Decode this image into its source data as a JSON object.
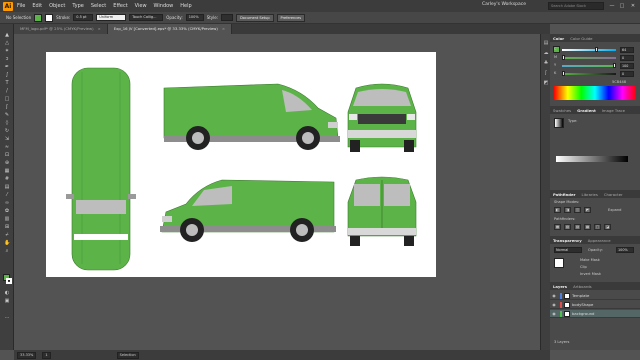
{
  "app": {
    "logo": "Ai",
    "menu": [
      "File",
      "Edit",
      "Object",
      "Type",
      "Select",
      "Effect",
      "View",
      "Window",
      "Help"
    ],
    "workspace": "Carley's Workspace",
    "search_placeholder": "Search Adobe Stock",
    "window_controls": [
      "—",
      "□",
      "✕"
    ]
  },
  "control_bar": {
    "selection": "No Selection",
    "fill_color": "#5cb448",
    "stroke_label": "Stroke:",
    "stroke_value": "0.5 pt",
    "brush": "Uniform",
    "style": "Touch Callig...",
    "opacity_label": "Opacity:",
    "opacity_value": "100%",
    "style_label": "Style:",
    "document_setup": "Document Setup",
    "preferences": "Preferences"
  },
  "tabs": [
    {
      "label": "MFM_logo.pdf* @ 25% (CMYK/Preview)",
      "active": false,
      "close": "×"
    },
    {
      "label": "Exp_16 JV [Converted].eps* @ 33.33% (CMYK/Preview)",
      "active": true,
      "close": "×"
    }
  ],
  "status_bar": {
    "zoom": "33.33%",
    "artboard": "1",
    "tool": "Selection"
  },
  "colors": {
    "van_green": "#5cb448",
    "van_dark": "#4a8c3a",
    "artboard": "#ffffff",
    "accent": "#ff9a00"
  },
  "panels": {
    "color": {
      "tabs": [
        "Color",
        "Color Guide"
      ],
      "channels": [
        {
          "label": "C",
          "value": "64",
          "knob": 0.64
        },
        {
          "label": "M",
          "value": "0",
          "knob": 0.0
        },
        {
          "label": "Y",
          "value": "100",
          "knob": 1.0
        },
        {
          "label": "K",
          "value": "0",
          "knob": 0.0
        }
      ],
      "hex": "5CB448"
    },
    "gradient": {
      "tabs": [
        "Swatches",
        "Gradient",
        "Image Trace"
      ],
      "type_label": "Type:"
    },
    "pathfinder": {
      "tabs": [
        "Pathfinder",
        "Libraries",
        "Character"
      ],
      "shape_modes": "Shape Modes:",
      "pathfinders": "Pathfinders:",
      "expand": "Expand"
    },
    "transparency": {
      "tabs": [
        "Transparency",
        "Appearance"
      ],
      "mode": "Normal",
      "opacity_label": "Opacity:",
      "opacity_value": "100%",
      "make_mask": "Make Mask",
      "clip": "Clip",
      "invert": "Invert Mask"
    },
    "layers": {
      "tabs": [
        "Layers",
        "Artboards"
      ],
      "items": [
        {
          "name": "Template",
          "color": "#4f7fe0"
        },
        {
          "name": "bodyShape",
          "color": "#e04f4f"
        },
        {
          "name": "background",
          "color": "#4fc04f"
        }
      ],
      "count": "3 Layers"
    }
  }
}
